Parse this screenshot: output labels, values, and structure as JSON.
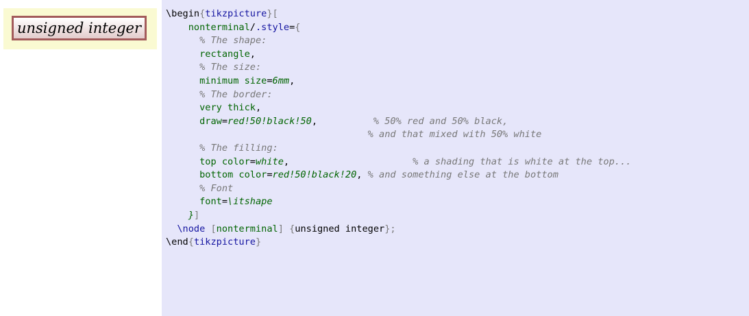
{
  "example": {
    "node_text": "unsigned integer"
  },
  "code": {
    "l1": {
      "begin": "\\begin",
      "ob": "{",
      "env": "tikzpicture",
      "cb": "}["
    },
    "l2": {
      "opt": "nonterminal",
      "slash": "/",
      "dotstyle": ".style",
      "eq": "=",
      "ob": "{"
    },
    "l3": {
      "comment": "% The shape:"
    },
    "l4": {
      "opt": "rectangle",
      "comma": ","
    },
    "l5": {
      "comment": "% The size:"
    },
    "l6": {
      "opt": "minimum size",
      "eq": "=",
      "val": "6mm",
      "comma": ","
    },
    "l7": {
      "comment": "% The border:"
    },
    "l8": {
      "opt": "very thick",
      "comma": ","
    },
    "l9": {
      "opt": "draw",
      "eq": "=",
      "val": "red!50!black!50",
      "comma": ",",
      "pad": "          ",
      "comment": "% 50% red and 50% black,"
    },
    "l10": {
      "pad": "                                    ",
      "comment": "% and that mixed with 50% white"
    },
    "l11": {
      "comment": "% The filling:"
    },
    "l12": {
      "opt": "top color",
      "eq": "=",
      "val": "white",
      "comma": ",",
      "pad": "                      ",
      "comment": "% a shading that is white at the top..."
    },
    "l13": {
      "opt": "bottom color",
      "eq": "=",
      "val": "red!50!black!20",
      "comma": ",",
      "pad": " ",
      "comment": "% and something else at the bottom"
    },
    "l14": {
      "comment": "% Font"
    },
    "l15": {
      "opt": "font",
      "eq": "=",
      "val": "\\itshape"
    },
    "l16": {
      "val": "}",
      "cb": "]"
    },
    "l17": {
      "cmd": "\\node",
      "ob": "[",
      "opt": "nonterminal",
      "cb": "]",
      "ob2": "{",
      "text": "unsigned integer",
      "cb2": "};"
    },
    "l18": {
      "end": "\\end",
      "ob": "{",
      "env": "tikzpicture",
      "cb": "}"
    }
  }
}
